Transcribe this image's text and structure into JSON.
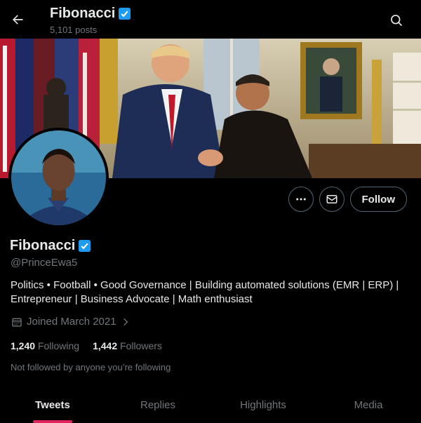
{
  "topbar": {
    "title": "Fibonacci",
    "posts_count": "5,101 posts"
  },
  "profile": {
    "name": "Fibonacci",
    "handle": "@PrinceEwa5",
    "bio": "Politics • Football • Good Governance | Building automated solutions (EMR | ERP) | Entrepreneur | Business Advocate | Math enthusiast",
    "joined": "Joined March 2021",
    "following_count": "1,240",
    "following_label": "Following",
    "followers_count": "1,442",
    "followers_label": "Followers",
    "not_followed": "Not followed by anyone you’re following"
  },
  "actions": {
    "follow_label": "Follow"
  },
  "tabs": [
    {
      "label": "Tweets"
    },
    {
      "label": "Replies"
    },
    {
      "label": "Highlights"
    },
    {
      "label": "Media"
    }
  ],
  "colors": {
    "background": "#000000",
    "verified": "#1d9bf0",
    "tab_indicator": "#e0245e",
    "muted_text": "#71767b"
  },
  "icons": [
    "back-arrow-icon",
    "search-icon",
    "verified-badge-icon",
    "more-icon",
    "message-icon",
    "calendar-icon",
    "chevron-right-icon"
  ]
}
